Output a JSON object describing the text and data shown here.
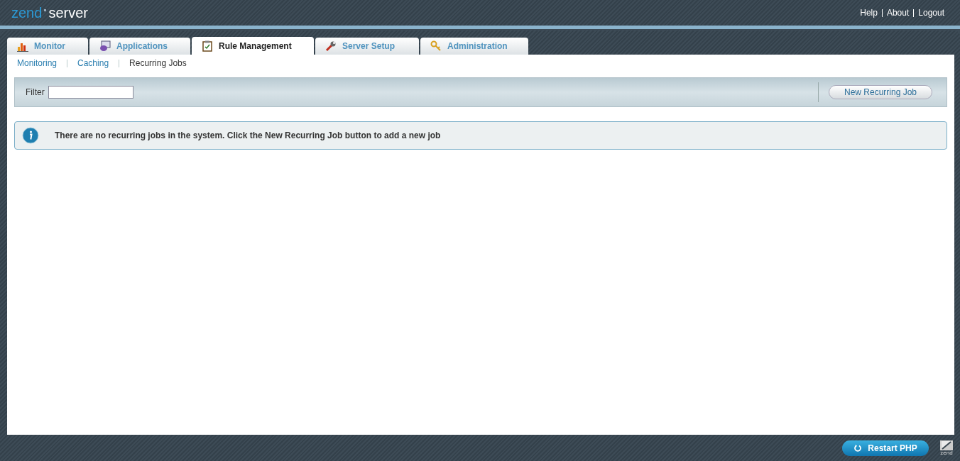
{
  "logo": {
    "brand": "zend",
    "product": "server"
  },
  "top_links": [
    "Help",
    "About",
    "Logout"
  ],
  "tabs": [
    {
      "label": "Monitor",
      "selected": false
    },
    {
      "label": "Applications",
      "selected": false
    },
    {
      "label": "Rule Management",
      "selected": true
    },
    {
      "label": "Server Setup",
      "selected": false
    },
    {
      "label": "Administration",
      "selected": false
    }
  ],
  "subnav": [
    {
      "label": "Monitoring",
      "selected": false
    },
    {
      "label": "Caching",
      "selected": false
    },
    {
      "label": "Recurring Jobs",
      "selected": true
    }
  ],
  "filter": {
    "label": "Filter"
  },
  "new_button": "New Recurring Job",
  "info_message": "There are no recurring jobs in the system. Click the New Recurring Job button to add a new job",
  "footer": {
    "restart_button": "Restart PHP",
    "logo_text": "zend"
  }
}
